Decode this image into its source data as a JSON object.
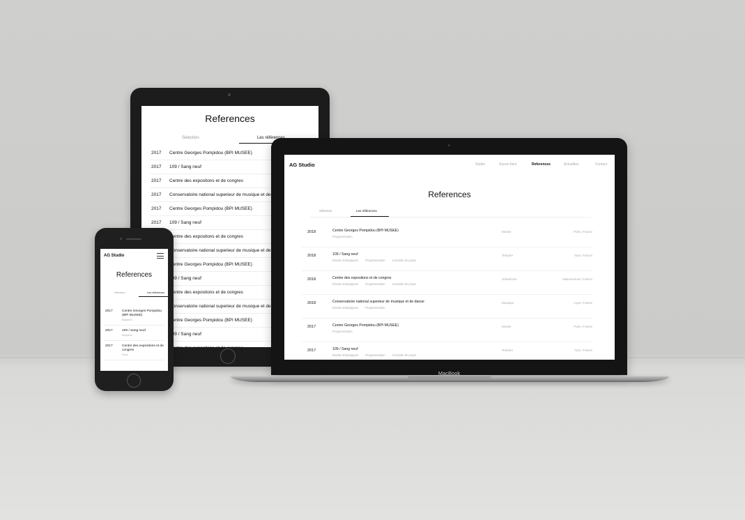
{
  "tablet": {
    "title": "References",
    "tabs": [
      "Sélection",
      "Les références"
    ],
    "rows": [
      {
        "year": "2017",
        "name": "Centre Georges Pompidou  (BPI MUSEE)"
      },
      {
        "year": "2017",
        "name": "109 / Sang neuf"
      },
      {
        "year": "2017",
        "name": "Centre des expositons et de congres"
      },
      {
        "year": "2017",
        "name": "Conservatoire national superieur de musique et de danse"
      },
      {
        "year": "2017",
        "name": "Centre Georges Pompidou  (BPI MUSEE)"
      },
      {
        "year": "2017",
        "name": "109 / Sang neuf"
      },
      {
        "year": "",
        "name": "Centre des expositons et de congres"
      },
      {
        "year": "",
        "name": "Conservatoire national superieur de musique et de danse"
      },
      {
        "year": "",
        "name": "Centre Georges Pompidou  (BPI MUSEE)"
      },
      {
        "year": "",
        "name": "109 / Sang neuf"
      },
      {
        "year": "",
        "name": "Centre des expositons et de congres"
      },
      {
        "year": "",
        "name": "Conservatoire national superieur de musique et de danse"
      },
      {
        "year": "",
        "name": "Centre Georges Pompidou  (BPI MUSEE)"
      },
      {
        "year": "",
        "name": "109 / Sang neuf"
      },
      {
        "year": "",
        "name": "Centre des expositons et de congres"
      }
    ]
  },
  "laptop": {
    "brand_label": "MacBook",
    "logo": "AG Studio",
    "nav": [
      "Studio",
      "Savoir-faire",
      "References",
      "Actualites",
      "Contact"
    ],
    "title": "References",
    "tabs": [
      "Sélection",
      "Les références"
    ],
    "rows": [
      {
        "year": "2018",
        "name": "Centre Georges Pompidou (BPI MUSEE)",
        "tags": [
          "Programmation"
        ],
        "category": "Musée",
        "location": "Paris, France"
      },
      {
        "year": "2018",
        "name": "109 / Sang neuf",
        "tags": [
          "Études stratégiques",
          "Programmation",
          "Conduite de projet"
        ],
        "category": "Tertiaire",
        "location": "Nice, France"
      },
      {
        "year": "2018",
        "name": "Centre des expositons et de congres",
        "tags": [
          "Études stratégiques",
          "Programmation",
          "Conduite de projet"
        ],
        "category": "Urbanisme",
        "location": "Valenciennes, France"
      },
      {
        "year": "2018",
        "name": "Conservatoire national superieur de musique et de danse",
        "tags": [
          "Études stratégiques",
          "Programmation"
        ],
        "category": "Musique",
        "location": "Lyon, France"
      },
      {
        "year": "2017",
        "name": "Centre Georges Pompidou (BPI MUSEE)",
        "tags": [
          "Programmation"
        ],
        "category": "Musée",
        "location": "Paris, France"
      },
      {
        "year": "2017",
        "name": "109 / Sang neuf",
        "tags": [
          "Études stratégiques",
          "Programmation",
          "Conduite de projet"
        ],
        "category": "Tertiaire",
        "location": "Nice, France"
      }
    ]
  },
  "phone": {
    "logo": "AG Studio",
    "title": "References",
    "tabs": [
      "Sélection",
      "Les références"
    ],
    "rows": [
      {
        "year": "2017",
        "name": "Centre Georges Pompidou  (BPI MUSEE)",
        "location": "Bagneux"
      },
      {
        "year": "2017",
        "name": "109 / Sang neuf",
        "location": "Bagneux"
      },
      {
        "year": "2017",
        "name": "Centre des expositons et de congres",
        "location": "Paris"
      }
    ]
  }
}
